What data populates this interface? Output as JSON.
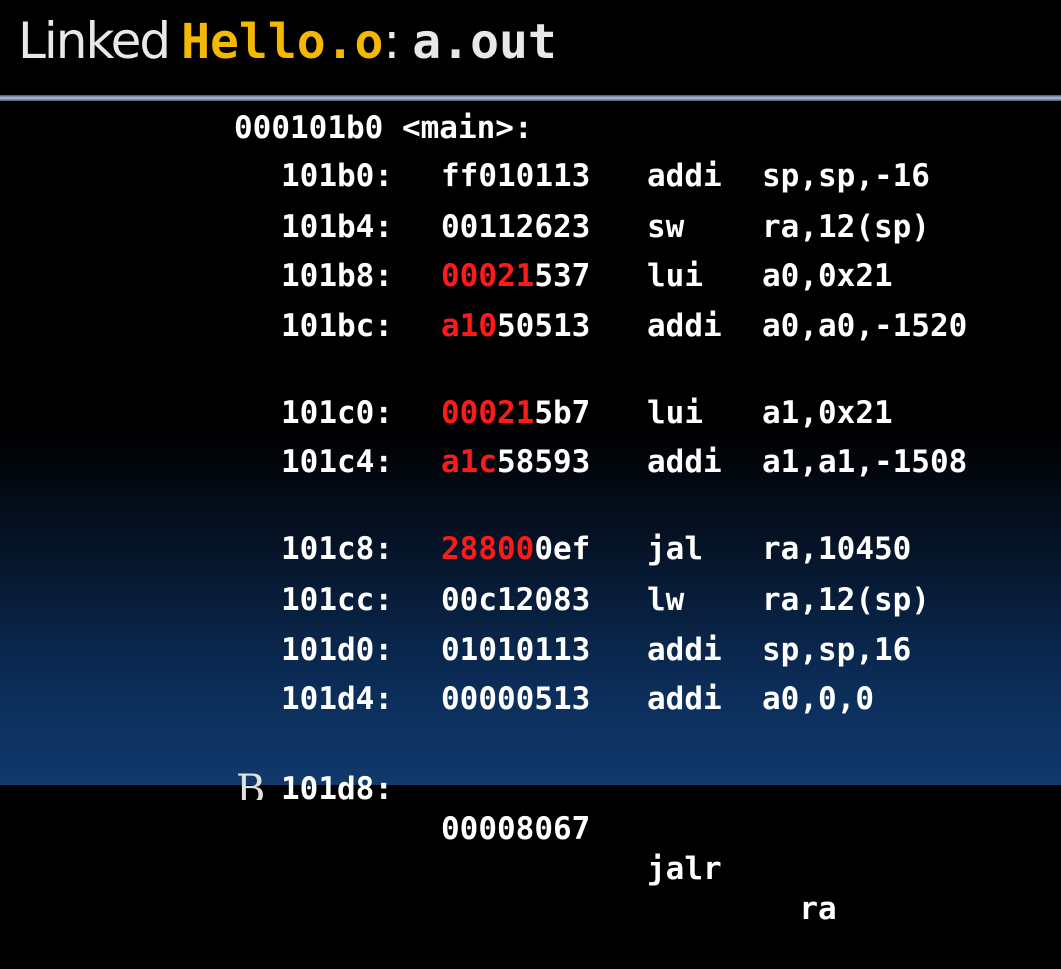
{
  "slide": {
    "title_word": "Linked",
    "title_file": "Hello.o",
    "title_colon": ":",
    "title_out": "a.out",
    "label_line": "000101b0 <main>:",
    "instructions": [
      {
        "addr": "101b0:",
        "hex_red": "",
        "hex_rest": "ff010113",
        "op": "addi",
        "args": "sp,sp,-16"
      },
      {
        "addr": "101b4:",
        "hex_red": "",
        "hex_rest": "00112623",
        "op": "sw",
        "args": "ra,12(sp)"
      },
      {
        "addr": "101b8:",
        "hex_red": "00021",
        "hex_rest": "537",
        "op": "lui",
        "args": "a0,0x21"
      },
      {
        "addr": "101bc:",
        "hex_red": "a10",
        "hex_rest": "50513",
        "op": "addi",
        "args": "a0,a0,-1520"
      },
      {
        "addr": "101c0:",
        "hex_red": "00021",
        "hex_rest": "5b7",
        "op": "lui",
        "args": "a1,0x21"
      },
      {
        "addr": "101c4:",
        "hex_red": "a1c",
        "hex_rest": "58593",
        "op": "addi",
        "args": "a1,a1,-1508"
      },
      {
        "addr": "101c8:",
        "hex_red": "28800",
        "hex_rest": "0ef",
        "op": "jal",
        "args": "ra,10450"
      },
      {
        "addr": "101cc:",
        "hex_red": "",
        "hex_rest": "00c12083",
        "op": "lw",
        "args": "ra,12(sp)"
      },
      {
        "addr": "101d0:",
        "hex_red": "",
        "hex_rest": "01010113",
        "op": "addi",
        "args": "sp,sp,16"
      },
      {
        "addr": "101d4:",
        "hex_red": "",
        "hex_rest": "00000513",
        "op": "addi",
        "args": "a0,0,0"
      },
      {
        "addr": "101d8:",
        "hex_red": "",
        "hex_rest": "00008067",
        "op": "jalr",
        "args": "  ra"
      }
    ],
    "cut_off_text": "B"
  }
}
